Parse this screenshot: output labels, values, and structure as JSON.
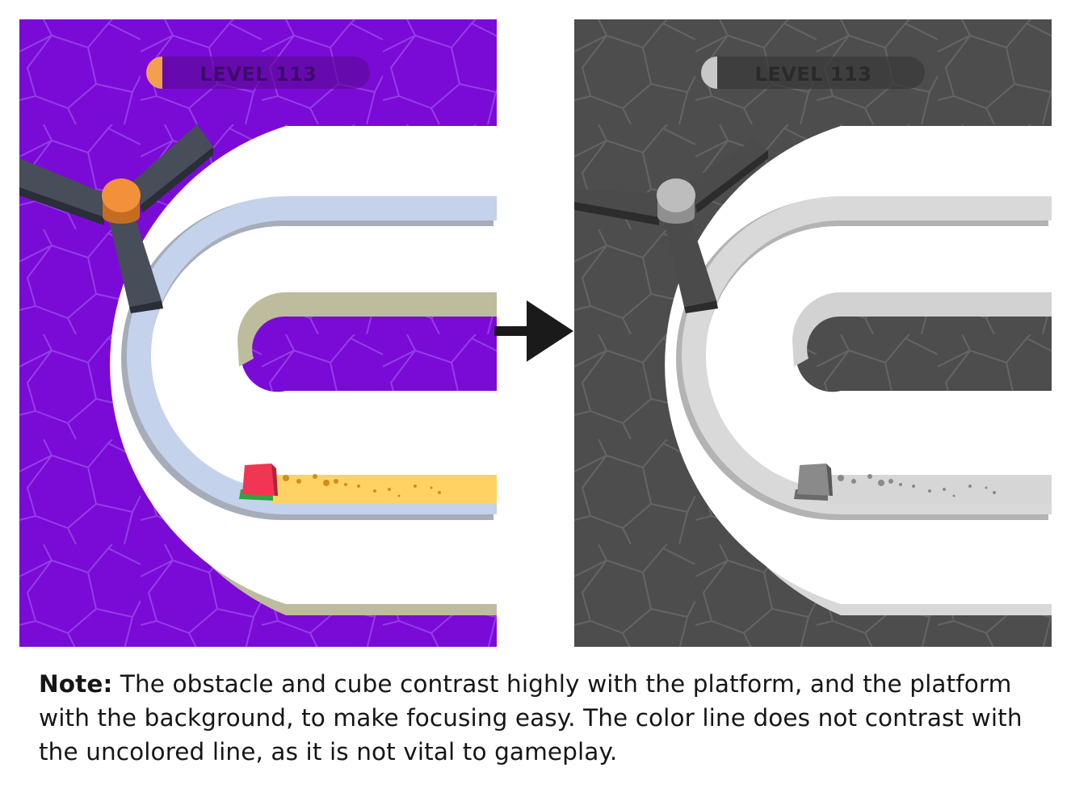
{
  "panels": {
    "color": {
      "hud": {
        "level_label": "LEVEL 113"
      },
      "colors": {
        "background": "#7a0bd6",
        "platform": "#ffffff",
        "platform_side": "#bdbc9c",
        "uncolored_line": "#c5d2ec",
        "colored_line": "#ffd363",
        "obstacle_arm": "#474d59",
        "obstacle_hub": "#f2913a",
        "cube_top": "#f03652",
        "cube_bottom": "#2aa641",
        "hud_indicator": "#f2a04c"
      }
    },
    "grayscale": {
      "hud": {
        "level_label": "LEVEL 113"
      },
      "colors": {
        "background": "#4d4d4d",
        "platform": "#ffffff",
        "platform_side": "#d8d8d8",
        "uncolored_line": "#d9d9d9",
        "colored_line": "#d6d6d6",
        "obstacle_arm": "#4b4b4b",
        "obstacle_hub": "#bdbdbd",
        "cube": "#8a8a8a",
        "hud_indicator": "#c8c8c8"
      }
    }
  },
  "transition_arrow_icon": "right-arrow-icon",
  "note": {
    "label": "Note:",
    "text": " The obstacle and cube contrast highly with the platform, and the platform with the background, to make focusing easy. The color line does not contrast with the uncolored line, as it is not vital to gameplay."
  }
}
